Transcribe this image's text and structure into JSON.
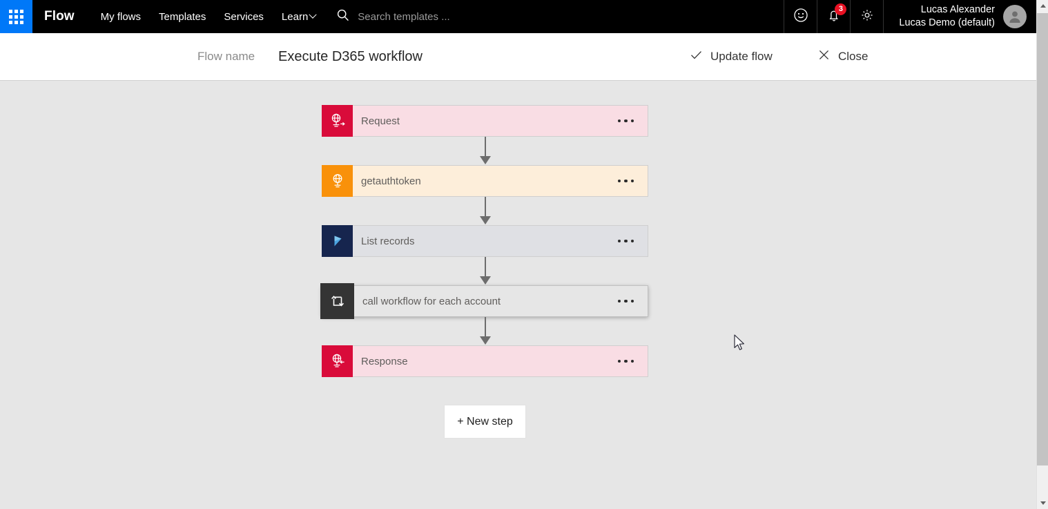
{
  "suite": {
    "waffle_icon": "app-launcher-waffle-icon",
    "brand": "Flow",
    "nav": [
      {
        "label": "My flows",
        "has_chevron": false
      },
      {
        "label": "Templates",
        "has_chevron": false
      },
      {
        "label": "Services",
        "has_chevron": false
      },
      {
        "label": "Learn",
        "has_chevron": true
      }
    ],
    "search": {
      "icon": "search-icon",
      "placeholder": "Search templates ...",
      "value": ""
    },
    "actions": {
      "feedback_icon": "smiley-face-icon",
      "notifications_icon": "bell-icon",
      "notifications_count": "3",
      "settings_icon": "gear-icon"
    },
    "user": {
      "name": "Lucas Alexander",
      "org": "Lucas Demo (default)",
      "avatar_icon": "person-avatar-icon"
    }
  },
  "command_bar": {
    "flow_name_label": "Flow name",
    "flow_name_value": "Execute D365 workflow",
    "update_label": "Update flow",
    "update_icon": "checkmark-icon",
    "close_label": "Close",
    "close_icon": "close-x-icon"
  },
  "designer": {
    "steps": [
      {
        "title": "Request",
        "icon": "http-request-globe-icon",
        "icon_bg": "#d90b3a",
        "body_bg": "#f9dde4",
        "selected": false,
        "menu_icon": "ellipsis-menu-icon"
      },
      {
        "title": "getauthtoken",
        "icon": "http-globe-icon",
        "icon_bg": "#f9910a",
        "body_bg": "#fdeeda",
        "selected": false,
        "menu_icon": "ellipsis-menu-icon"
      },
      {
        "title": "List records",
        "icon": "dynamics365-play-icon",
        "icon_bg": "#16254e",
        "body_bg": "#dfe0e4",
        "selected": false,
        "menu_icon": "ellipsis-menu-icon"
      },
      {
        "title": "call workflow for each account",
        "icon": "apply-to-each-loop-icon",
        "icon_bg": "#343434",
        "body_bg": "#e6e6e6",
        "selected": true,
        "menu_icon": "ellipsis-menu-icon"
      },
      {
        "title": "Response",
        "icon": "http-response-globe-icon",
        "icon_bg": "#d90b3a",
        "body_bg": "#f9dde4",
        "selected": false,
        "menu_icon": "ellipsis-menu-icon"
      }
    ],
    "new_step_label": "+ New step"
  },
  "scrollbar": {
    "up_icon": "scroll-up-arrow-icon",
    "down_icon": "scroll-down-arrow-icon"
  }
}
